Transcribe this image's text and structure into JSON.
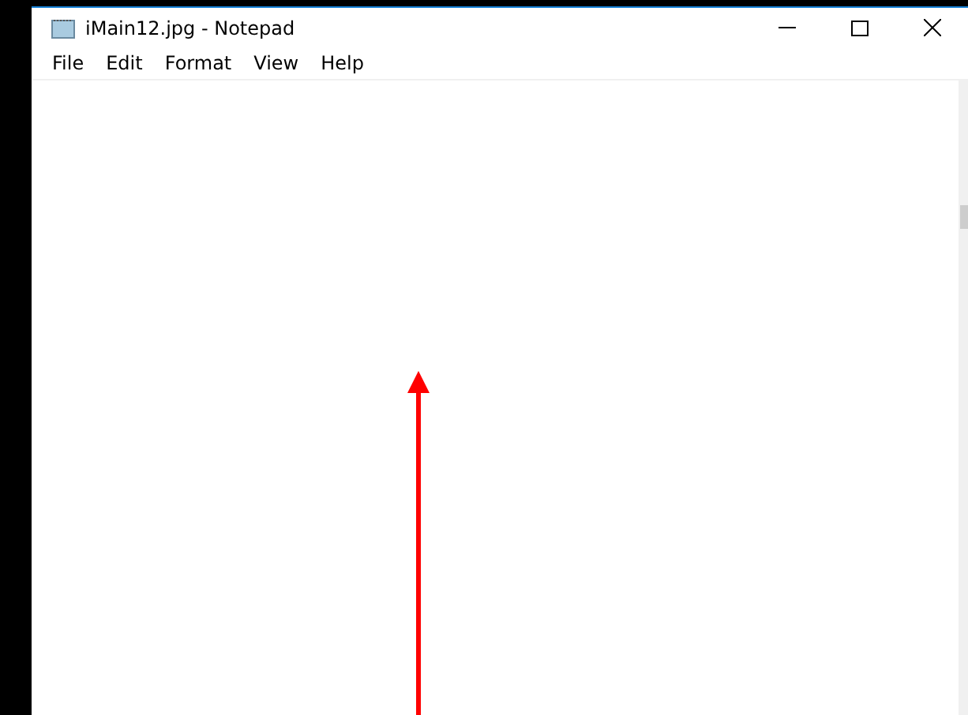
{
  "window": {
    "title": "iMain12.jpg - Notepad"
  },
  "menu": [
    "File",
    "Edit",
    "Format",
    "View",
    "Help"
  ]
}
